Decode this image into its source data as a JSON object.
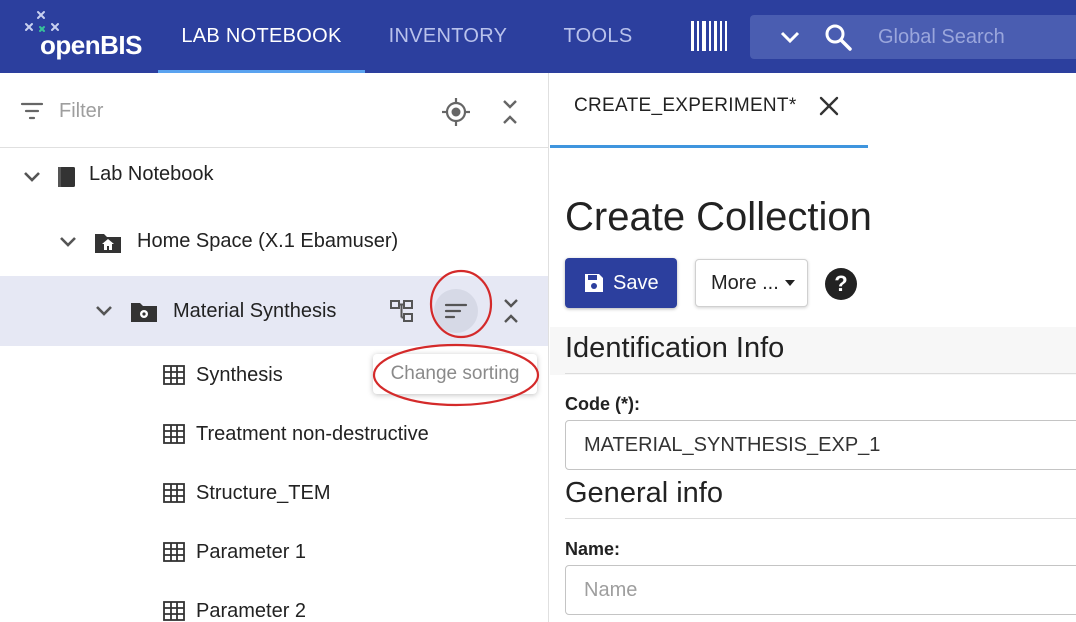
{
  "app": {
    "logo_text": "openBIS",
    "nav": [
      {
        "label": "LAB NOTEBOOK",
        "active": true
      },
      {
        "label": "INVENTORY",
        "active": false
      },
      {
        "label": "TOOLS",
        "active": false
      }
    ],
    "search": {
      "placeholder": "Global Search"
    }
  },
  "sidebar": {
    "filter_placeholder": "Filter",
    "tree": [
      {
        "label": "Lab Notebook",
        "icon": "notebook-icon",
        "expanded": true
      },
      {
        "label": "Home Space (X.1 Ebamuser)",
        "icon": "home-icon",
        "expanded": true
      },
      {
        "label": "Material Synthesis",
        "icon": "project-folder-icon",
        "expanded": true,
        "selected": true
      },
      {
        "label": "Synthesis",
        "icon": "table-icon"
      },
      {
        "label": "Treatment non-destructive",
        "icon": "table-icon"
      },
      {
        "label": "Structure_TEM",
        "icon": "table-icon"
      },
      {
        "label": "Parameter 1",
        "icon": "table-icon"
      },
      {
        "label": "Parameter 2",
        "icon": "table-icon"
      }
    ],
    "tooltip": "Change sorting"
  },
  "main": {
    "tab_label": "CREATE_EXPERIMENT*",
    "title": "Create Collection",
    "save_label": "Save",
    "more_label": "More ...",
    "sections": {
      "identification": "Identification Info",
      "general": "General info"
    },
    "fields": {
      "code_label": "Code (*):",
      "code_value": "MATERIAL_SYNTHESIS_EXP_1",
      "name_label": "Name:",
      "name_placeholder": "Name"
    }
  },
  "colors": {
    "topbar": "#2c3f9e",
    "accent": "#3f95de",
    "annotation": "#d42a2a"
  }
}
